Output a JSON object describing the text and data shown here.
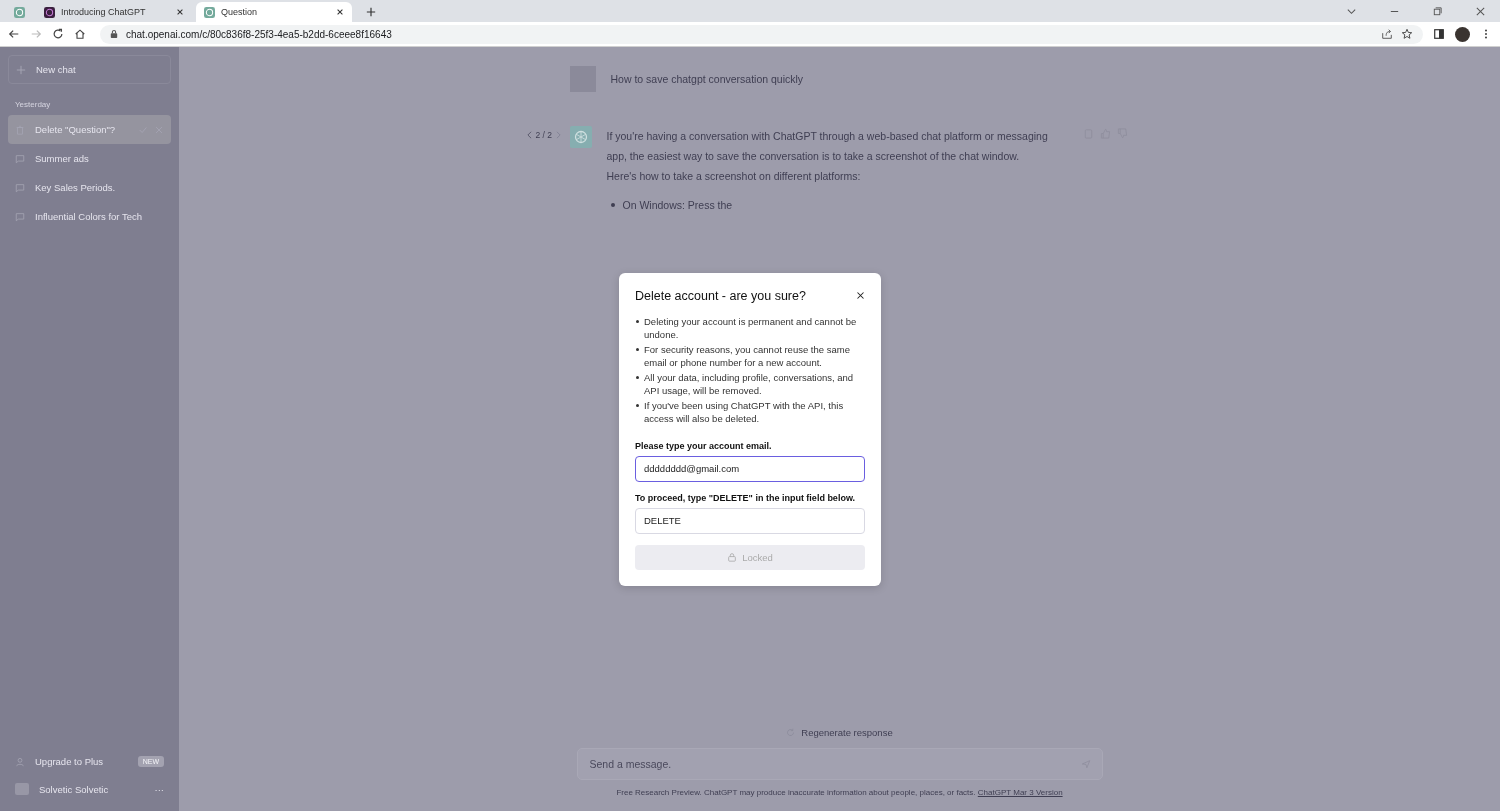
{
  "browser": {
    "tabs": [
      {
        "kind": "pinned",
        "selected": false
      },
      {
        "title": "Introducing ChatGPT",
        "kind": "normal",
        "selected": false
      },
      {
        "title": "Question",
        "kind": "normal",
        "selected": true
      }
    ],
    "url": "chat.openai.com/c/80c836f8-25f3-4ea5-b2dd-6ceee8f16643"
  },
  "sidebar": {
    "new_chat": "New chat",
    "section": "Yesterday",
    "items": [
      {
        "label": "Delete \"Question\"?",
        "kind": "confirm",
        "selected": true
      },
      {
        "label": "Summer ads",
        "kind": "chat",
        "selected": false
      },
      {
        "label": "Key Sales Periods.",
        "kind": "chat",
        "selected": false
      },
      {
        "label": "Influential Colors for Tech",
        "kind": "chat",
        "selected": false
      }
    ],
    "upgrade": {
      "label": "Upgrade to Plus",
      "badge": "NEW"
    },
    "user": {
      "name": "Solvetic Solvetic",
      "menu": "···"
    }
  },
  "chat": {
    "user_message": "How to save chatgpt conversation quickly",
    "pager": "2 / 2",
    "answer": "If you're having a conversation with ChatGPT through a web-based chat platform or messaging app, the easiest way to save the conversation is to take a screenshot of the chat window. Here's how to take a screenshot on different platforms:",
    "answer_bullets": [
      "On Windows: Press the"
    ],
    "regenerate": "Regenerate response",
    "input_placeholder": "Send a message.",
    "footer": "Free Research Preview. ChatGPT may produce inaccurate information about people, places, or facts.",
    "footer_link": "ChatGPT Mar 3 Version"
  },
  "modal": {
    "title": "Delete account - are you sure?",
    "bullets": [
      "Deleting your account is permanent and cannot be undone.",
      "For security reasons, you cannot reuse the same email or phone number for a new account.",
      "All your data, including profile, conversations, and API usage, will be removed.",
      "If you've been using ChatGPT with the API, this access will also be deleted."
    ],
    "email_label": "Please type your account email.",
    "email_value": "dddddddd@gmail.com",
    "email_focused": true,
    "confirm_label": "To proceed, type \"DELETE\" in the input field below.",
    "confirm_value": "DELETE",
    "button": {
      "label": "Locked",
      "disabled": true
    }
  }
}
